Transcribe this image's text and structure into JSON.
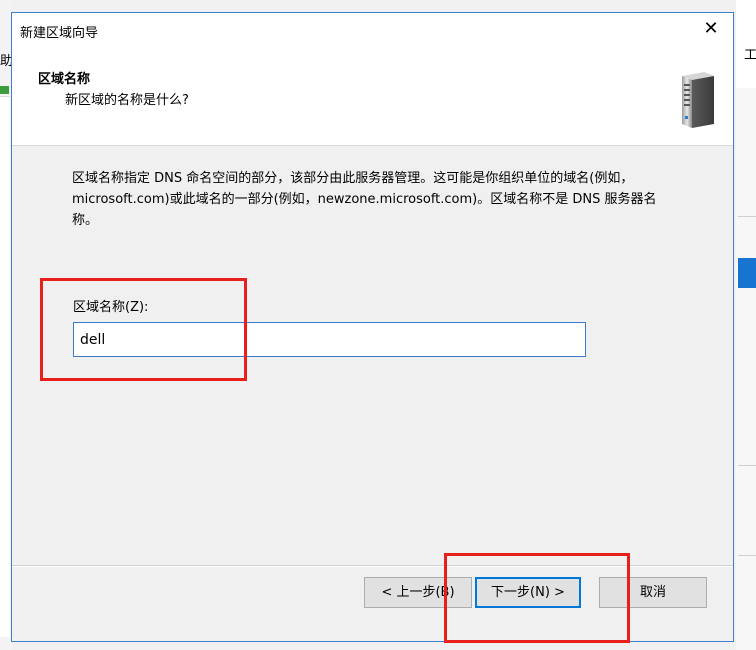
{
  "background": {
    "left_char": "助",
    "right_char": "工"
  },
  "dialog": {
    "title": "新建区域向导",
    "close_glyph": "✕",
    "header": {
      "title": "区域名称",
      "subtitle": "新区域的名称是什么?"
    },
    "description": "区域名称指定 DNS 命名空间的部分，该部分由此服务器管理。这可能是你组织单位的域名(例如，microsoft.com)或此域名的一部分(例如，newzone.microsoft.com)。区域名称不是 DNS 服务器名称。",
    "zone_name_label": "区域名称(Z):",
    "zone_name_value": "dell",
    "buttons": {
      "back": "< 上一步(B)",
      "next": "下一步(N) >",
      "cancel": "取消"
    }
  },
  "colors": {
    "annotation": "#e8201c",
    "focus_border": "#0078d7",
    "selection_blue": "#1874d1"
  }
}
